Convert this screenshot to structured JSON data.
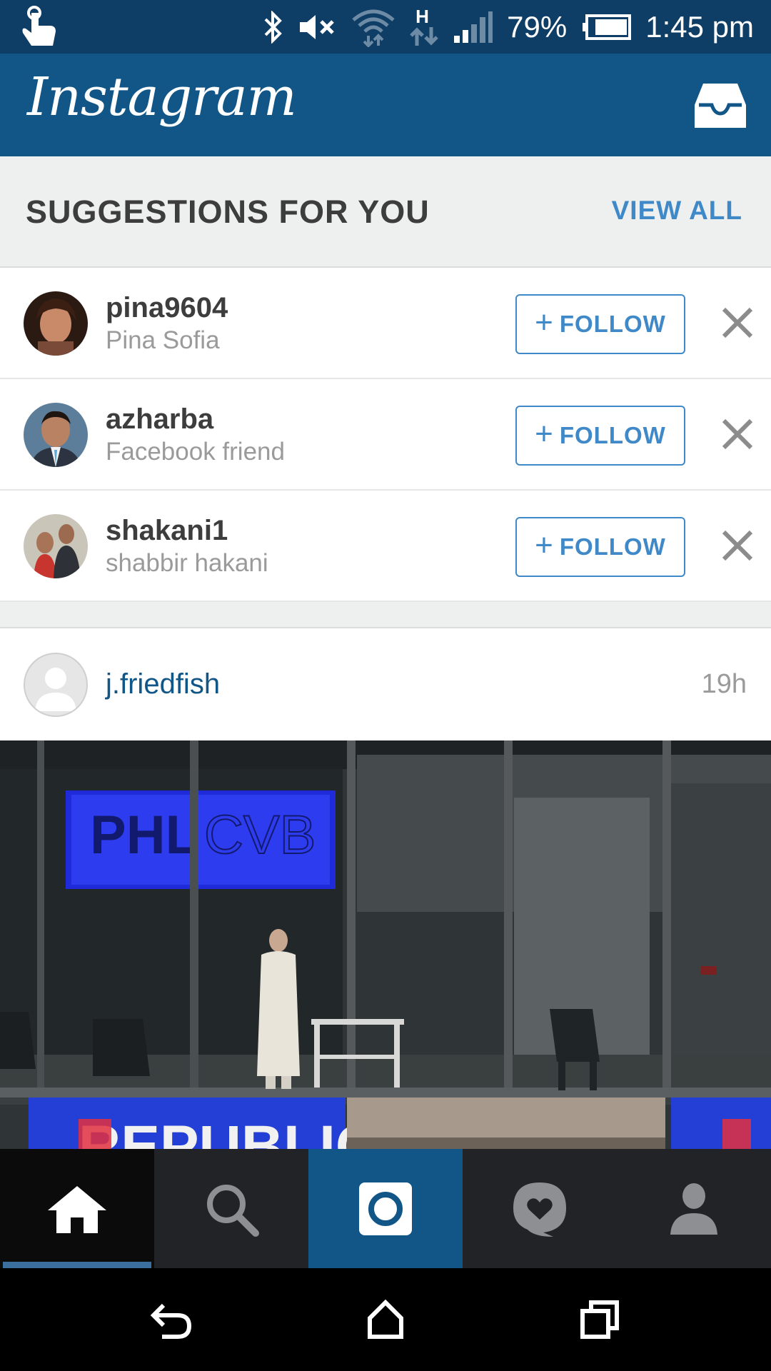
{
  "status_bar": {
    "battery": "79%",
    "time": "1:45 pm",
    "network_type": "H",
    "icons": [
      "touch-hand-icon",
      "bluetooth-icon",
      "mute-icon",
      "wifi-icon",
      "network-type-icon",
      "signal-icon",
      "battery-icon"
    ]
  },
  "header": {
    "logo": "Instagram",
    "inbox_icon": "inbox-icon"
  },
  "suggestions": {
    "title": "SUGGESTIONS FOR YOU",
    "view_all": "VIEW ALL",
    "items": [
      {
        "username": "pina9604",
        "subtitle": "Pina Sofia",
        "follow_label": "FOLLOW"
      },
      {
        "username": "azharba",
        "subtitle": "Facebook friend",
        "follow_label": "FOLLOW"
      },
      {
        "username": "shakani1",
        "subtitle": "shabbir hakani",
        "follow_label": "FOLLOW"
      }
    ]
  },
  "post": {
    "username": "j.friedfish",
    "time": "19h",
    "image_signs": {
      "top_sign_left": "PHL",
      "top_sign_right": "CVB",
      "bottom_sign": "REPUBLIC"
    }
  },
  "bottom_nav": {
    "tabs": [
      "home-icon",
      "search-icon",
      "camera-icon",
      "activity-icon",
      "profile-icon"
    ],
    "active_tab": "home-icon"
  },
  "system_nav": [
    "back-icon",
    "home-sys-icon",
    "recents-icon"
  ],
  "colors": {
    "status_bar": "#0e3d66",
    "header": "#125688",
    "accent": "#3f89c8",
    "link": "#125688",
    "nav_bg": "#212326"
  }
}
